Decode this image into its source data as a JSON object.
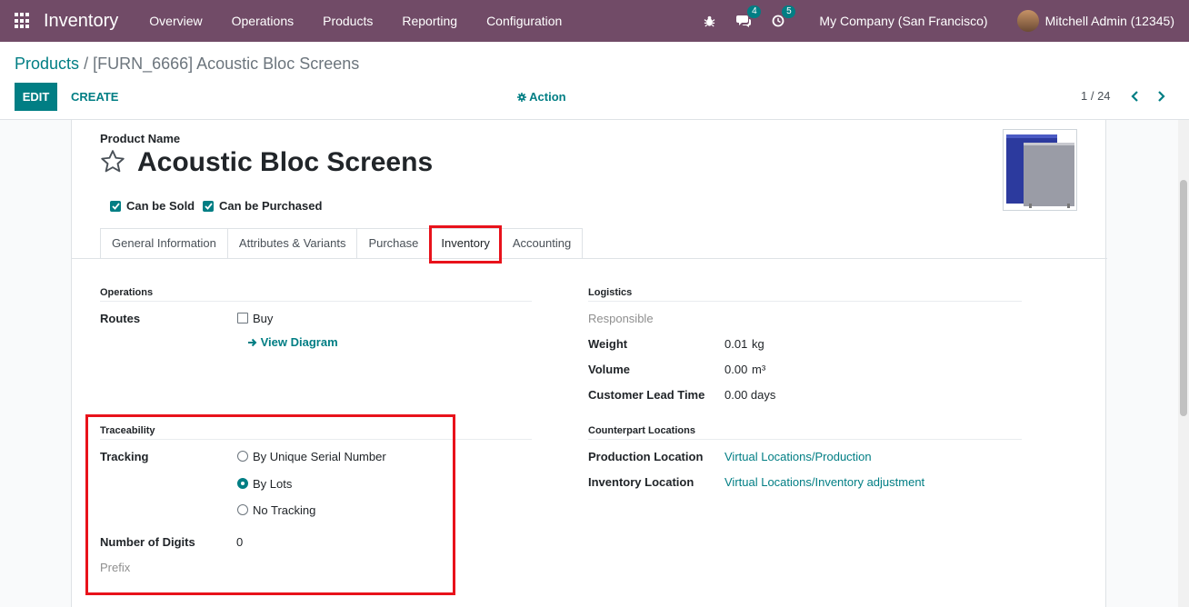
{
  "navbar": {
    "app_title": "Inventory",
    "menu": [
      "Overview",
      "Operations",
      "Products",
      "Reporting",
      "Configuration"
    ],
    "messages_badge": "4",
    "activities_badge": "5",
    "company": "My Company (San Francisco)",
    "user": "Mitchell Admin (12345)"
  },
  "breadcrumb": {
    "parent": "Products",
    "separator": "/",
    "current": "[FURN_6666] Acoustic Bloc Screens"
  },
  "toolbar": {
    "edit_label": "EDIT",
    "create_label": "CREATE",
    "action_label": "Action"
  },
  "pager": {
    "value": "1 / 24"
  },
  "product": {
    "name_label": "Product Name",
    "name": "Acoustic Bloc Screens",
    "can_be_sold_label": "Can be Sold",
    "can_be_purchased_label": "Can be Purchased"
  },
  "tabs": [
    "General Information",
    "Attributes & Variants",
    "Purchase",
    "Inventory",
    "Accounting"
  ],
  "operations": {
    "title": "Operations",
    "routes_label": "Routes",
    "route_buy": "Buy",
    "view_diagram": "View Diagram"
  },
  "logistics": {
    "title": "Logistics",
    "responsible_label": "Responsible",
    "weight_label": "Weight",
    "weight_value": "0.01",
    "weight_unit": "kg",
    "volume_label": "Volume",
    "volume_value": "0.00",
    "volume_unit": "m³",
    "lead_time_label": "Customer Lead Time",
    "lead_time_value": "0.00 days"
  },
  "traceability": {
    "title": "Traceability",
    "tracking_label": "Tracking",
    "options": [
      "By Unique Serial Number",
      "By Lots",
      "No Tracking"
    ],
    "selected": "By Lots",
    "digits_label": "Number of Digits",
    "digits_value": "0",
    "prefix_label": "Prefix"
  },
  "counterpart": {
    "title": "Counterpart Locations",
    "production_label": "Production Location",
    "production_value": "Virtual Locations/Production",
    "inventory_label": "Inventory Location",
    "inventory_value": "Virtual Locations/Inventory adjustment"
  },
  "colors": {
    "brand": "#714b67",
    "accent": "#017e84",
    "highlight": "#e8121b"
  }
}
